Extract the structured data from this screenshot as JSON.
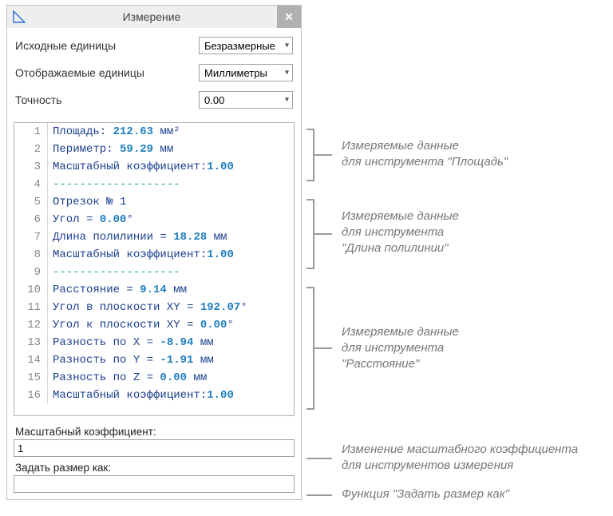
{
  "window": {
    "title": "Измерение",
    "close": "✕"
  },
  "options": {
    "source_units_label": "Исходные единицы",
    "source_units_value": "Безразмерные",
    "display_units_label": "Отображаемые единицы",
    "display_units_value": "Миллиметры",
    "precision_label": "Точность",
    "precision_value": "0.00"
  },
  "code": {
    "lines": [
      {
        "n": "1",
        "segs": [
          {
            "t": "Площадь: ",
            "c": "tk-key"
          },
          {
            "t": "212.63",
            "c": "tk-num"
          },
          {
            "t": " мм²",
            "c": "tk-unit"
          }
        ]
      },
      {
        "n": "2",
        "segs": [
          {
            "t": "Периметр: ",
            "c": "tk-key"
          },
          {
            "t": "59.29",
            "c": "tk-num"
          },
          {
            "t": " мм",
            "c": "tk-unit"
          }
        ]
      },
      {
        "n": "3",
        "segs": [
          {
            "t": "Масштабный коэффициент:",
            "c": "tk-key"
          },
          {
            "t": "1.00",
            "c": "tk-num"
          }
        ]
      },
      {
        "n": "4",
        "segs": [
          {
            "t": "-------------------",
            "c": "tk-dash"
          }
        ]
      },
      {
        "n": "5",
        "segs": [
          {
            "t": "Отрезок № 1",
            "c": "tk-key"
          }
        ]
      },
      {
        "n": "6",
        "segs": [
          {
            "t": "Угол = ",
            "c": "tk-key"
          },
          {
            "t": "0.00",
            "c": "tk-num"
          },
          {
            "t": "°",
            "c": "tk-unit"
          }
        ]
      },
      {
        "n": "7",
        "segs": [
          {
            "t": "Длина полилинии = ",
            "c": "tk-key"
          },
          {
            "t": "18.28",
            "c": "tk-num"
          },
          {
            "t": " мм",
            "c": "tk-unit"
          }
        ]
      },
      {
        "n": "8",
        "segs": [
          {
            "t": "Масштабный коэффициент:",
            "c": "tk-key"
          },
          {
            "t": "1.00",
            "c": "tk-num"
          }
        ]
      },
      {
        "n": "9",
        "segs": [
          {
            "t": "-------------------",
            "c": "tk-dash"
          }
        ]
      },
      {
        "n": "10",
        "segs": [
          {
            "t": "Расстояние = ",
            "c": "tk-key"
          },
          {
            "t": "9.14",
            "c": "tk-num"
          },
          {
            "t": " мм",
            "c": "tk-unit"
          }
        ]
      },
      {
        "n": "11",
        "segs": [
          {
            "t": "Угол в плоскости XY = ",
            "c": "tk-key"
          },
          {
            "t": "192.07",
            "c": "tk-num"
          },
          {
            "t": "°",
            "c": "tk-unit"
          }
        ]
      },
      {
        "n": "12",
        "segs": [
          {
            "t": "Угол к плоскости XY = ",
            "c": "tk-key"
          },
          {
            "t": "0.00",
            "c": "tk-num"
          },
          {
            "t": "°",
            "c": "tk-unit"
          }
        ]
      },
      {
        "n": "13",
        "segs": [
          {
            "t": "Разность по X = ",
            "c": "tk-key"
          },
          {
            "t": "-8.94",
            "c": "tk-num"
          },
          {
            "t": " мм",
            "c": "tk-unit"
          }
        ]
      },
      {
        "n": "14",
        "segs": [
          {
            "t": "Разность по Y = ",
            "c": "tk-key"
          },
          {
            "t": "-1.91",
            "c": "tk-num"
          },
          {
            "t": " мм",
            "c": "tk-unit"
          }
        ]
      },
      {
        "n": "15",
        "segs": [
          {
            "t": "Разность по Z = ",
            "c": "tk-key"
          },
          {
            "t": "0.00",
            "c": "tk-num"
          },
          {
            "t": " мм",
            "c": "tk-unit"
          }
        ]
      },
      {
        "n": "16",
        "segs": [
          {
            "t": "Масштабный коэффициент:",
            "c": "tk-key"
          },
          {
            "t": "1.00",
            "c": "tk-num"
          }
        ]
      }
    ]
  },
  "bottom": {
    "scale_label": "Масштабный коэффициент:",
    "scale_value": "1",
    "setsize_label": "Задать размер как:",
    "setsize_value": ""
  },
  "annotations": {
    "a1_l1": "Измеряемые данные",
    "a1_l2": "для инструмента \"Площадь\"",
    "a2_l1": "Измеряемые данные",
    "a2_l2": "для инструмента",
    "a2_l3": "\"Длина полилинии\"",
    "a3_l1": "Измеряемые данные",
    "a3_l2": "для инструмента",
    "a3_l3": "\"Расстояние\"",
    "a4_l1": "Изменение масштабного коэффициента",
    "a4_l2": "для инструментов измерения",
    "a5": "Функция \"Задать размер как\""
  }
}
